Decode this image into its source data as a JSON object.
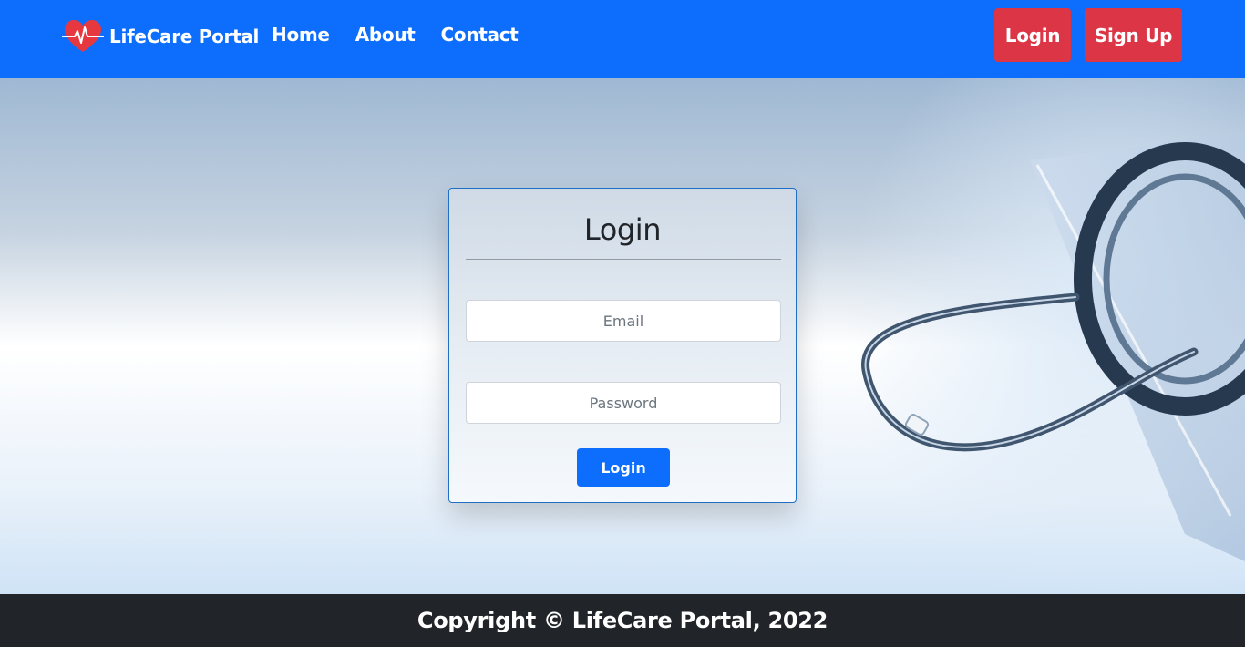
{
  "brand": {
    "name": "LifeCare Portal",
    "logo_icon": "heart-pulse-icon"
  },
  "nav": {
    "links": [
      "Home",
      "About",
      "Contact"
    ],
    "login_label": "Login",
    "signup_label": "Sign Up"
  },
  "login_form": {
    "title": "Login",
    "email_placeholder": "Email",
    "password_placeholder": "Password",
    "submit_label": "Login"
  },
  "footer": {
    "text": "Copyright © LifeCare Portal, 2022"
  },
  "colors": {
    "navbar": "#0d6efd",
    "nav_buttons": "#dc3545",
    "submit_button": "#0d6efd",
    "footer": "#212529",
    "card_border": "#1f6fc4"
  }
}
